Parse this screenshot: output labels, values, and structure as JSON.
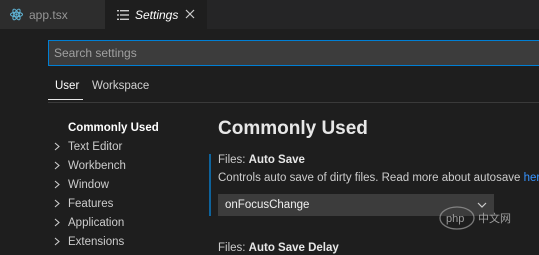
{
  "tabs": [
    {
      "label": "app.tsx",
      "icon": "react-icon",
      "active": false
    },
    {
      "label": "Settings",
      "icon": "settings-list-icon",
      "active": true
    }
  ],
  "search": {
    "placeholder": "Search settings",
    "value": ""
  },
  "scope_tabs": [
    {
      "label": "User",
      "active": true
    },
    {
      "label": "Workspace",
      "active": false
    }
  ],
  "toc": [
    {
      "label": "Commonly Used",
      "expandable": false,
      "selected": true
    },
    {
      "label": "Text Editor",
      "expandable": true
    },
    {
      "label": "Workbench",
      "expandable": true
    },
    {
      "label": "Window",
      "expandable": true
    },
    {
      "label": "Features",
      "expandable": true
    },
    {
      "label": "Application",
      "expandable": true
    },
    {
      "label": "Extensions",
      "expandable": true
    }
  ],
  "section": {
    "title": "Commonly Used"
  },
  "auto_save": {
    "category": "Files: ",
    "name": "Auto Save",
    "description": "Controls auto save of dirty files. Read more about autosave ",
    "link_text": "here",
    "after_link": ".",
    "value": "onFocusChange"
  },
  "auto_save_delay": {
    "category": "Files: ",
    "name": "Auto Save Delay"
  },
  "colors": {
    "accent": "#007fd4",
    "link": "#3794ff",
    "background": "#1e1e1e",
    "tab_bar": "#252526"
  },
  "watermark": "php中文网"
}
